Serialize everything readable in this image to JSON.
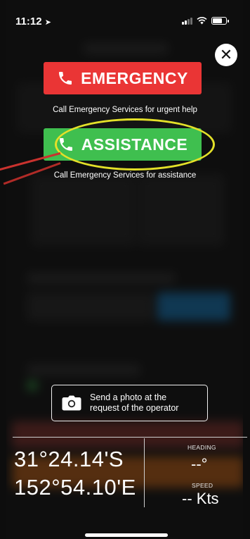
{
  "status_bar": {
    "time": "11:12",
    "location_icon": "location-arrow-icon",
    "signal_icon": "cellular-signal-icon",
    "wifi_icon": "wifi-icon",
    "battery_icon": "battery-icon"
  },
  "modal": {
    "close_icon": "close-icon",
    "emergency": {
      "label": "EMERGENCY",
      "caption": "Call Emergency Services for urgent help",
      "color": "#ea3535",
      "icon": "phone-icon"
    },
    "assistance": {
      "label": "ASSISTANCE",
      "caption": "Call Emergency Services for assistance",
      "color": "#3fbf4f",
      "icon": "phone-icon"
    },
    "photo": {
      "label_line1": "Send a photo at the",
      "label_line2": "request of the operator",
      "icon": "camera-icon"
    }
  },
  "position": {
    "latitude": "31°24.14'S",
    "longitude": "152°54.10'E",
    "heading_label": "HEADING",
    "heading_value": "--°",
    "speed_label": "SPEED",
    "speed_value": "-- Kts"
  },
  "annotation": {
    "highlight_color": "#e3e029",
    "pointer_color": "#c9322e"
  }
}
